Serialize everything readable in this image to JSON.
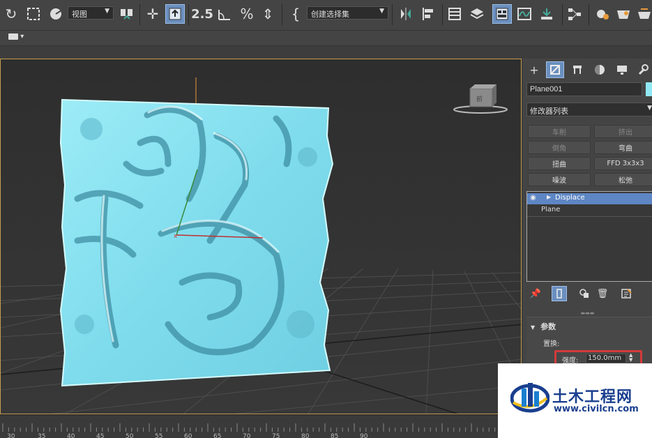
{
  "toolbar": {
    "view_dropdown": "视图",
    "selection_set_dropdown": "创建选择集",
    "snap_label": "2.5"
  },
  "toolbar2": {
    "menu_glyph": "▾"
  },
  "viewport": {
    "selected_color": "#8fe8f2",
    "object_name": "Plane001"
  },
  "command_panel": {
    "object_name": "Plane001",
    "modifier_list": "修改器列表",
    "modifier_buttons": [
      {
        "label": "车削",
        "enabled": false
      },
      {
        "label": "挤出",
        "enabled": false
      },
      {
        "label": "倒角",
        "enabled": false
      },
      {
        "label": "弯曲",
        "enabled": true
      },
      {
        "label": "扭曲",
        "enabled": true
      },
      {
        "label": "FFD 3x3x3",
        "enabled": true
      },
      {
        "label": "噪波",
        "enabled": true
      },
      {
        "label": "松弛",
        "enabled": true
      }
    ],
    "stack": [
      {
        "label": "Displace",
        "selected": true
      },
      {
        "label": "Plane",
        "selected": false
      }
    ],
    "rollout": {
      "title": "参数",
      "group": "置换:",
      "strength_label": "强度:",
      "strength_value": "150.0mm"
    }
  },
  "timeline": {
    "ticks": [
      "30",
      "35",
      "40",
      "45",
      "50",
      "55",
      "60",
      "65",
      "70",
      "75",
      "80",
      "85",
      "90"
    ]
  },
  "watermark": {
    "title": "土木工程网",
    "url": "www.civilcn.com"
  }
}
